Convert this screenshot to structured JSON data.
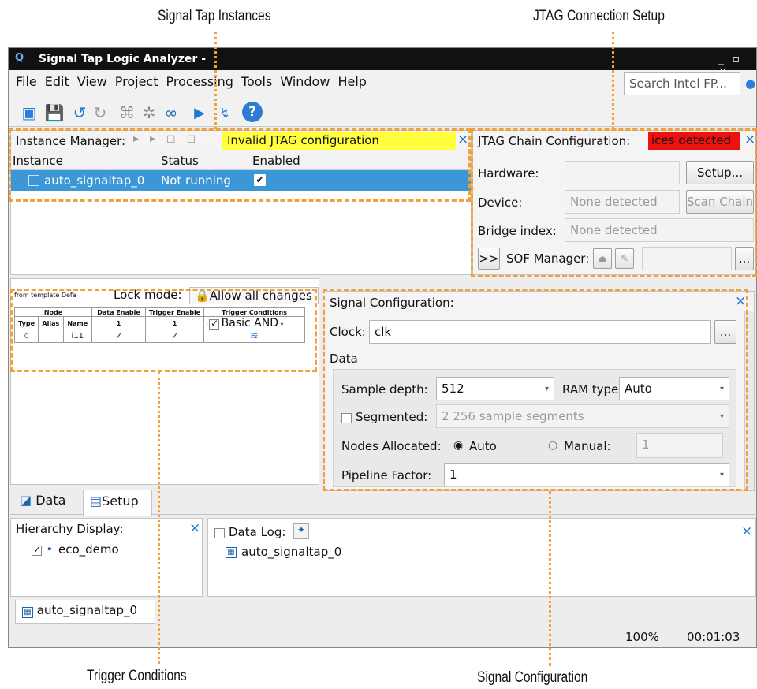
{
  "callouts": {
    "signal_tap_instances": "Signal Tap Instances",
    "jtag_connection_setup": "JTAG Connection Setup",
    "trigger_conditions": "Trigger Conditions",
    "signal_configuration": "Signal Configuration"
  },
  "window": {
    "title": "Signal Tap Logic Analyzer -",
    "controls": "_ ▫ ×"
  },
  "menu": [
    "File",
    "Edit",
    "View",
    "Project",
    "Processing",
    "Tools",
    "Window",
    "Help"
  ],
  "search": {
    "placeholder": "Search Intel FP..."
  },
  "instance_manager": {
    "title": "Instance Manager:",
    "status_banner": "Invalid JTAG configuration",
    "columns": [
      "Instance",
      "Status",
      "Enabled"
    ],
    "rows": [
      {
        "instance": "auto_signaltap_0",
        "status": "Not running",
        "enabled": "✔"
      }
    ]
  },
  "jtag": {
    "title": "JTAG Chain Configuration:",
    "status_banner": "ices detected",
    "hardware_label": "Hardware:",
    "hardware_value": "",
    "setup_button": "Setup...",
    "device_label": "Device:",
    "device_value": "None detected",
    "scan_chain_button": "Scan Chain",
    "bridge_label": "Bridge index:",
    "bridge_value": "None detected",
    "expand_button": ">>",
    "sof_label": "SOF Manager:",
    "browse_button": "..."
  },
  "trigger": {
    "template_text": "from template Defa",
    "lock_mode_label": "Lock mode:",
    "lock_mode_value": "Allow all changes",
    "col_node": "Node",
    "col_data_enable": "Data Enable",
    "col_trigger_enable": "Trigger Enable",
    "col_trigger_conditions": "Trigger Conditions",
    "col_type": "Type",
    "col_alias": "Alias",
    "col_name": "Name",
    "data_enable_count": "1",
    "trigger_enable_count": "1",
    "trigger_condition_index": "1",
    "basic_and": "Basic AND",
    "row_name": "i11",
    "row_type": "C"
  },
  "signal_config": {
    "title": "Signal Configuration:",
    "clock_label": "Clock:",
    "clock_value": "clk",
    "browse_button": "...",
    "data_heading": "Data",
    "sample_depth_label": "Sample depth:",
    "sample_depth_value": "512",
    "ram_type_label": "RAM type:",
    "ram_type_value": "Auto",
    "segmented_label": "Segmented:",
    "segmented_value": "2  256 sample segments",
    "nodes_allocated_label": "Nodes Allocated:",
    "auto_label": "Auto",
    "manual_label": "Manual:",
    "manual_value": "1",
    "pipeline_label": "Pipeline Factor:",
    "pipeline_value": "1"
  },
  "tabs": {
    "data": "Data",
    "setup": "Setup"
  },
  "hierarchy": {
    "title": "Hierarchy Display:",
    "item": "eco_demo"
  },
  "data_log": {
    "title": "Data Log:",
    "item": "auto_signaltap_0"
  },
  "bottom_tab": "auto_signaltap_0",
  "status_bar": {
    "zoom": "100%",
    "time": "00:01:03"
  },
  "colors": {
    "selection": "#3b97d6",
    "yellow_banner": "#ffff3d",
    "red_banner": "#ee1111",
    "callout_dash": "#f0a13a"
  }
}
